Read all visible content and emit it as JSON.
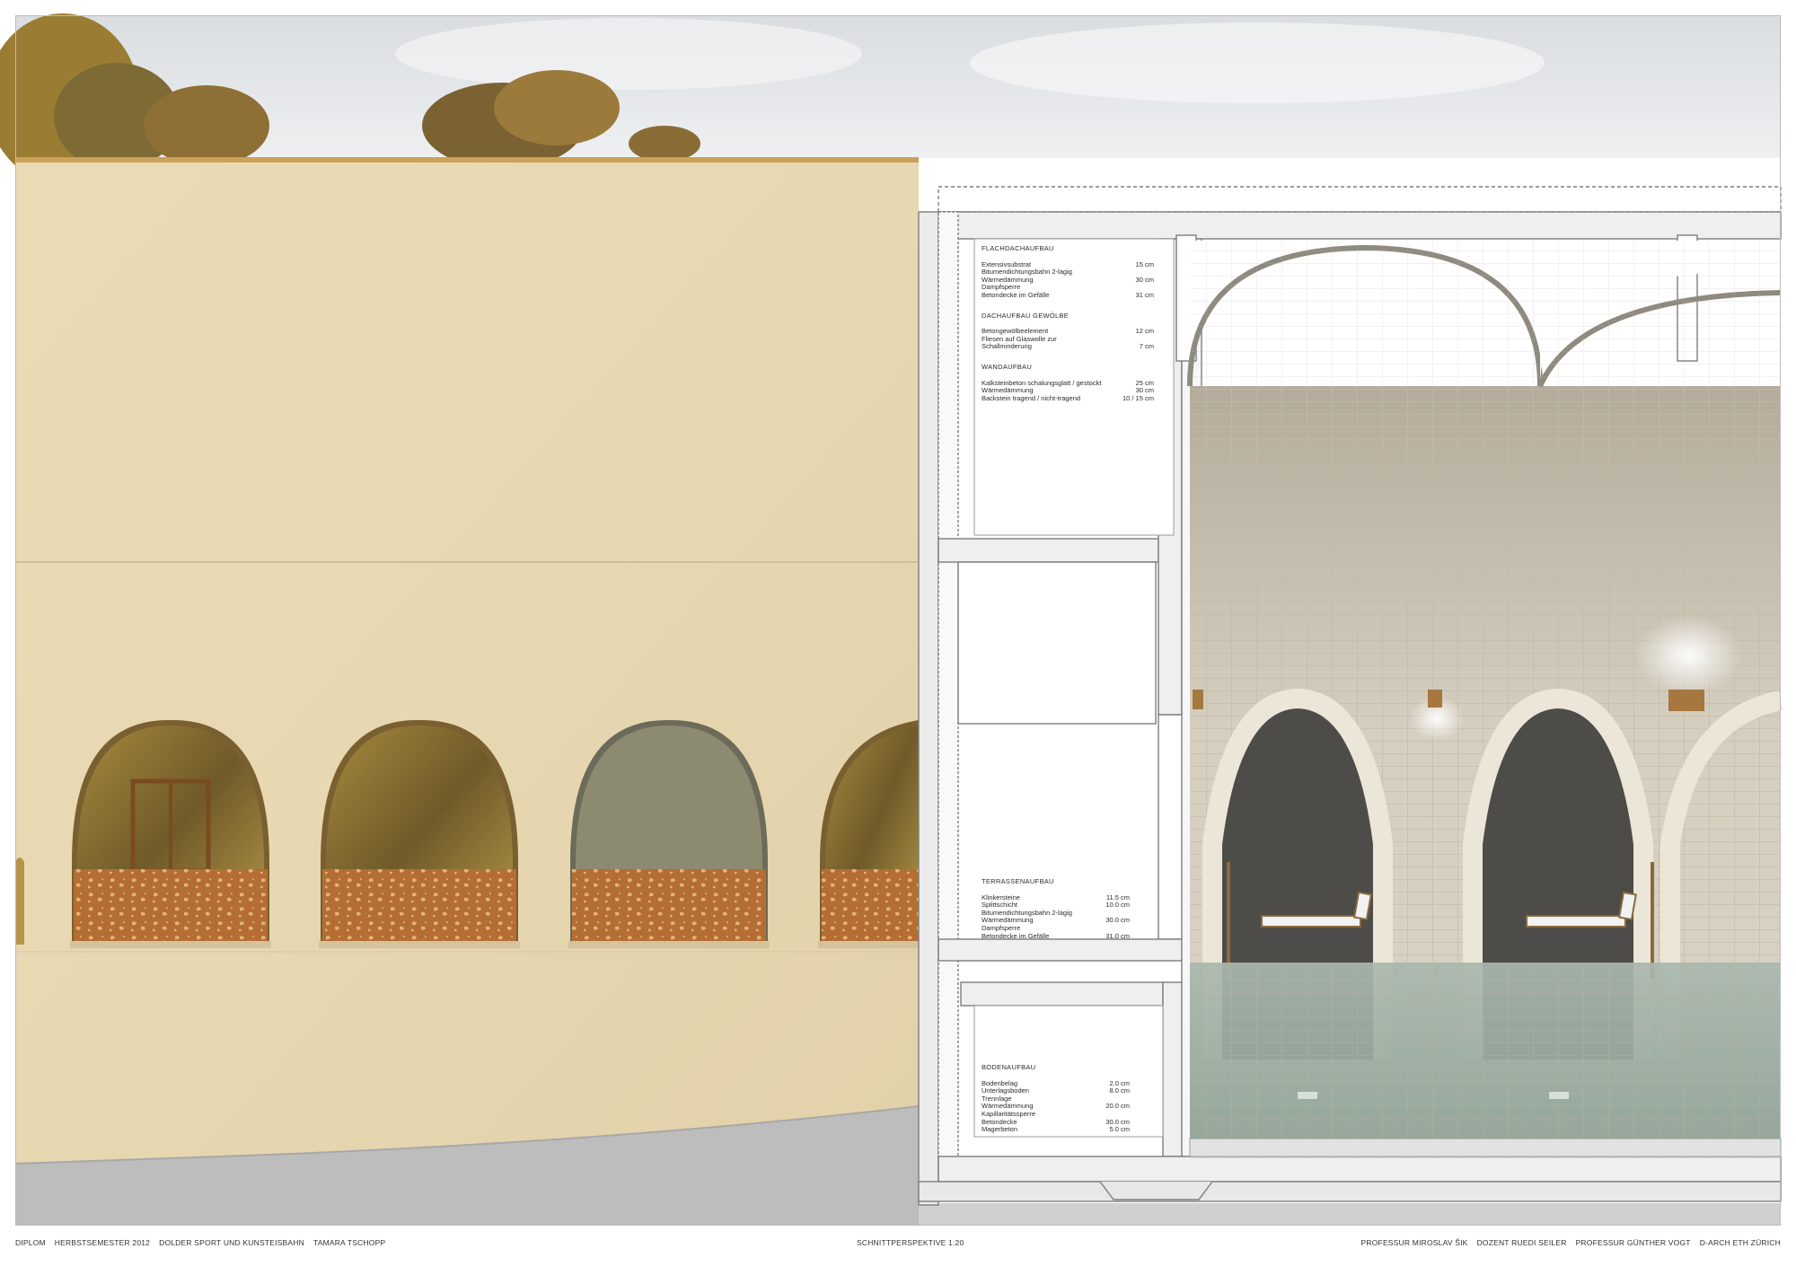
{
  "specs": {
    "flachdach": {
      "heading": "FLACHDACHAUFBAU",
      "rows": [
        {
          "label": "Extensivsubstrat",
          "value": "15 cm"
        },
        {
          "label": "Bitumendichtungsbahn 2-lagig",
          "value": ""
        },
        {
          "label": "Wärmedämmung",
          "value": "30 cm"
        },
        {
          "label": "Dampfsperre",
          "value": ""
        },
        {
          "label": "Betondecke im Gefälle",
          "value": "31 cm"
        }
      ]
    },
    "gewoelbe": {
      "heading": "DACHAUFBAU GEWÖLBE",
      "rows": [
        {
          "label": "Betongewölbeelement",
          "value": "12 cm"
        },
        {
          "label": "Fliesen auf Glaswolle zur",
          "value": ""
        },
        {
          "label": "Schallminderung",
          "value": "7 cm"
        }
      ]
    },
    "wand": {
      "heading": "WANDAUFBAU",
      "rows": [
        {
          "label": "Kalksteinbeton schalungsglatt / gestockt",
          "value": "25 cm"
        },
        {
          "label": "Wärmedämmung",
          "value": "30 cm"
        },
        {
          "label": "Backstein tragend / nicht-tragend",
          "value": "10 / 15 cm"
        }
      ]
    },
    "terrasse": {
      "heading": "TERRASSENAUFBAU",
      "rows": [
        {
          "label": "Klinkersteine",
          "value": "11.5 cm"
        },
        {
          "label": "Splittschicht",
          "value": "10.0 cm"
        },
        {
          "label": "Bitumendichtungsbahn 2-lagig",
          "value": ""
        },
        {
          "label": "Wärmedämmung",
          "value": "30.0 cm"
        },
        {
          "label": "Dampfsperre",
          "value": ""
        },
        {
          "label": "Betondecke im Gefälle",
          "value": "31.0 cm"
        }
      ]
    },
    "boden": {
      "heading": "BODENAUFBAU",
      "rows": [
        {
          "label": "Bodenbelag",
          "value": "2.0 cm"
        },
        {
          "label": "Unterlagsboden",
          "value": "8.0 cm"
        },
        {
          "label": "Trennlage",
          "value": ""
        },
        {
          "label": "Wärmedämmung",
          "value": "20.0 cm"
        },
        {
          "label": "Kapillaritätssperre",
          "value": ""
        },
        {
          "label": "Betondecke",
          "value": "30.0 cm"
        },
        {
          "label": "Magerbeton",
          "value": "5.0 cm"
        }
      ]
    }
  },
  "footer": {
    "diplom": "DIPLOM",
    "semester": "HERBSTSEMESTER 2012",
    "project": "DOLDER SPORT UND KUNSTEISBAHN",
    "author": "TAMARA TSCHOPP",
    "drawing": "SCHNITTPERSPEKTIVE 1:20",
    "professor1": "PROFESSUR MIROSLAV ŠIK",
    "dozent": "DOZENT RUEDI SEILER",
    "professor2": "PROFESSUR GÜNTHER VOGT",
    "school": "D-ARCH ETH ZÜRICH"
  },
  "colors": {
    "facade": "#e6d6b0",
    "sky": "#e4e7e8",
    "ground": "#bdbdbd",
    "tile": "#d2cbbb",
    "water": "#9eb0a3",
    "screen": "#b66f34",
    "alcove": "#4a4a48"
  }
}
